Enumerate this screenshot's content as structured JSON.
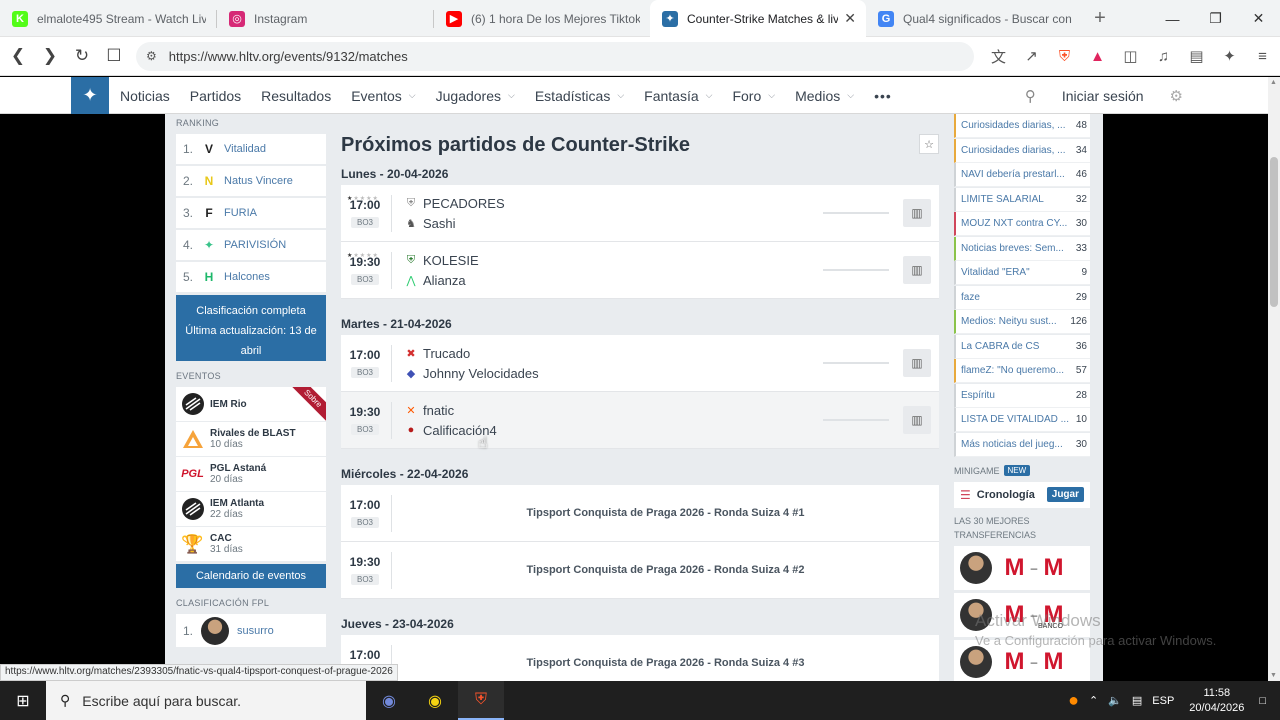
{
  "browser": {
    "tabs": [
      {
        "title": "elmalote495 Stream - Watch Live o",
        "icon": "kick-icon",
        "color": "#53fc18",
        "active": false
      },
      {
        "title": "Instagram",
        "icon": "instagram-icon",
        "color": "#d62976",
        "active": false
      },
      {
        "title": "(6) 1 hora De los Mejores Tiktoks d",
        "icon": "youtube-icon",
        "color": "#ff0000",
        "active": false
      },
      {
        "title": "Counter-Strike Matches & live",
        "icon": "hltv-icon",
        "color": "#2b6ea5",
        "active": true
      },
      {
        "title": "Qual4 significados - Buscar con G",
        "icon": "google-icon",
        "color": "#4285f4",
        "active": false
      }
    ],
    "url": "https://www.hltv.org/events/9132/matches",
    "status_url": "https://www.hltv.org/matches/2393305/fnatic-vs-qual4-tipsport-conquest-of-prague-2026"
  },
  "nav": {
    "items": [
      {
        "label": "Noticias",
        "dropdown": false
      },
      {
        "label": "Partidos",
        "dropdown": false
      },
      {
        "label": "Resultados",
        "dropdown": false
      },
      {
        "label": "Eventos",
        "dropdown": true
      },
      {
        "label": "Jugadores",
        "dropdown": true
      },
      {
        "label": "Estadísticas",
        "dropdown": true
      },
      {
        "label": "Fantasía",
        "dropdown": true
      },
      {
        "label": "Foro",
        "dropdown": true
      },
      {
        "label": "Medios",
        "dropdown": true
      }
    ],
    "more": "•••",
    "login": "Iniciar sesión"
  },
  "left": {
    "ranking_header": "RANKING",
    "ranking": [
      {
        "num": "1.",
        "team": "Vitalidad",
        "icon": "V",
        "icon_color": "#222"
      },
      {
        "num": "2.",
        "team": "Natus Vincere",
        "icon": "N",
        "icon_color": "#e8c81a"
      },
      {
        "num": "3.",
        "team": "FURIA",
        "icon": "F",
        "icon_color": "#222"
      },
      {
        "num": "4.",
        "team": "PARIVISIÓN",
        "icon": "✦",
        "icon_color": "#39c38a"
      },
      {
        "num": "5.",
        "team": "Halcones",
        "icon": "H",
        "icon_color": "#1db86a"
      }
    ],
    "full_ranking": "Clasificación completa",
    "last_update": "Última actualización: 13 de abril",
    "events_header": "EVENTOS",
    "events": [
      {
        "name": "IEM Rio",
        "days": "",
        "icon": "esl",
        "ribbon": "Sobre"
      },
      {
        "name": "Rivales de BLAST",
        "days": "10 días",
        "icon": "blast",
        "ribbon": ""
      },
      {
        "name": "PGL Astaná",
        "days": "20 días",
        "icon": "pgl",
        "ribbon": ""
      },
      {
        "name": "IEM Atlanta",
        "days": "22 días",
        "icon": "esl",
        "ribbon": ""
      },
      {
        "name": "CAC",
        "days": "31 días",
        "icon": "trophy",
        "ribbon": ""
      }
    ],
    "calendar": "Calendario de eventos",
    "fpl_header": "CLASIFICACIÓN FPL",
    "fpl": [
      {
        "num": "1.",
        "player": "susurro"
      }
    ]
  },
  "main": {
    "title": "Próximos partidos de Counter-Strike",
    "days": [
      {
        "label": "Lunes - 20-04-2026",
        "matches": [
          {
            "time": "17:00",
            "format": "BO3",
            "stars": 1,
            "team1": "PECADORES",
            "team2": "Sashi",
            "logo1": "⛨",
            "logo2": "♞",
            "c1": "#888",
            "c2": "#555",
            "placeholder": ""
          },
          {
            "time": "19:30",
            "format": "BO3",
            "stars": 1,
            "team1": "KOLESIE",
            "team2": "Alianza",
            "logo1": "⛨",
            "logo2": "⋀",
            "c1": "#2e7d32",
            "c2": "#2ecc71",
            "placeholder": ""
          }
        ]
      },
      {
        "label": "Martes - 21-04-2026",
        "matches": [
          {
            "time": "17:00",
            "format": "BO3",
            "stars": 0,
            "team1": "Trucado",
            "team2": "Johnny Velocidades",
            "logo1": "✖",
            "logo2": "◆",
            "c1": "#d32f2f",
            "c2": "#3f51b5",
            "placeholder": ""
          },
          {
            "time": "19:30",
            "format": "BO3",
            "stars": 0,
            "team1": "fnatic",
            "team2": "Calificación4",
            "logo1": "✕",
            "logo2": "●",
            "c1": "#ff5900",
            "c2": "#b71c1c",
            "placeholder": ""
          }
        ]
      },
      {
        "label": "Miércoles - 22-04-2026",
        "matches": [
          {
            "time": "17:00",
            "format": "BO3",
            "stars": 0,
            "team1": "",
            "team2": "",
            "placeholder": "Tipsport Conquista de Praga 2026 - Ronda Suiza 4 #1"
          },
          {
            "time": "19:30",
            "format": "BO3",
            "stars": 0,
            "team1": "",
            "team2": "",
            "placeholder": "Tipsport Conquista de Praga 2026 - Ronda Suiza 4 #2"
          }
        ]
      },
      {
        "label": "Jueves - 23-04-2026",
        "matches": [
          {
            "time": "17:00",
            "format": "BO3",
            "stars": 0,
            "team1": "",
            "team2": "",
            "placeholder": "Tipsport Conquista de Praga 2026 - Ronda Suiza 4 #3"
          }
        ]
      }
    ]
  },
  "right": {
    "threads": [
      {
        "title": "Curiosidades diarias, ...",
        "count": "48",
        "color": "orange"
      },
      {
        "title": "Curiosidades diarias, ...",
        "count": "34",
        "color": "orange"
      },
      {
        "title": "NAVI debería prestarl...",
        "count": "46",
        "color": "gray"
      },
      {
        "title": "LÍMITE SALARIAL",
        "count": "32",
        "color": "gray"
      },
      {
        "title": "MOUZ NXT contra CY...",
        "count": "30",
        "color": "red"
      },
      {
        "title": "Noticias breves: Sem...",
        "count": "33",
        "color": "green"
      },
      {
        "title": "Vitalidad \"ERA\"",
        "count": "9",
        "color": "gray"
      },
      {
        "title": "faze",
        "count": "29",
        "color": "gray"
      },
      {
        "title": "Medios: Neityu sust...",
        "count": "126",
        "color": "green"
      },
      {
        "title": "La CABRA de CS",
        "count": "36",
        "color": "gray"
      },
      {
        "title": "flameZ: \"No queremo...",
        "count": "57",
        "color": "orange"
      },
      {
        "title": "Espíritu",
        "count": "28",
        "color": "gray"
      },
      {
        "title": "LISTA DE VITALIDAD ...",
        "count": "10",
        "color": "gray"
      },
      {
        "title": "Más noticias del jueg...",
        "count": "30",
        "color": "gray"
      }
    ],
    "minigame_header": "MINIGAME",
    "minigame_new": "NEW",
    "minigame_name": "Cronología",
    "minigame_play": "Jugar",
    "transfers_header": "LAS 30 MEJORES TRANSFERENCIAS",
    "transfers": [
      {
        "from": "M",
        "to": "M",
        "tag": ""
      },
      {
        "from": "M",
        "to": "M",
        "tag": "BANCO"
      },
      {
        "from": "M",
        "to": "M",
        "tag": ""
      }
    ]
  },
  "watermark": {
    "line1": "Activar Windows",
    "line2": "Ve a Configuración para activar Windows."
  },
  "taskbar": {
    "search_placeholder": "Escribe aquí para buscar.",
    "lang": "ESP",
    "time": "11:58",
    "date": "20/04/2026"
  }
}
